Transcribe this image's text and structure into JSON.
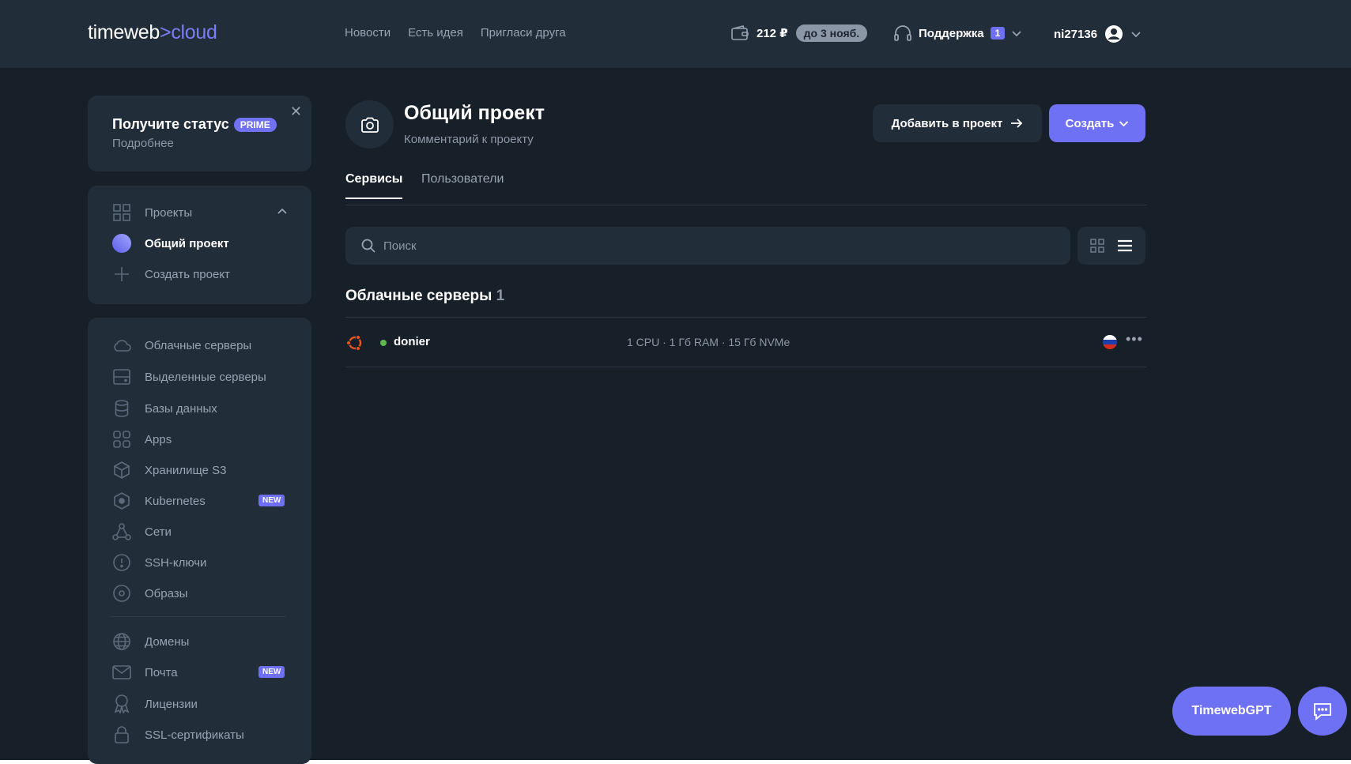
{
  "header": {
    "logo_left": "timeweb",
    "logo_sep": ">",
    "logo_right": "cloud",
    "nav": [
      "Новости",
      "Есть идея",
      "Пригласи друга"
    ],
    "balance": "212 ₽",
    "balance_until": "до 3 нояб.",
    "support_label": "Поддержка",
    "support_count": "1",
    "username": "ni27136"
  },
  "sidebar": {
    "prime_title": "Получите статус",
    "prime_tag": "PRIME",
    "prime_more": "Подробнее",
    "close_glyph": "✕",
    "projects_label": "Проекты",
    "current_project": "Общий проект",
    "create_project": "Создать проект",
    "items": [
      {
        "label": "Облачные серверы",
        "icon": "cloud-icon"
      },
      {
        "label": "Выделенные серверы",
        "icon": "server-icon"
      },
      {
        "label": "Базы данных",
        "icon": "database-icon"
      },
      {
        "label": "Apps",
        "icon": "apps-icon"
      },
      {
        "label": "Хранилище S3",
        "icon": "cube-icon"
      },
      {
        "label": "Kubernetes",
        "icon": "kubernetes-icon",
        "badge": "NEW"
      },
      {
        "label": "Сети",
        "icon": "network-icon"
      },
      {
        "label": "SSH-ключи",
        "icon": "key-icon"
      },
      {
        "label": "Образы",
        "icon": "disc-icon"
      },
      {
        "label": "Домены",
        "icon": "globe-icon"
      },
      {
        "label": "Почта",
        "icon": "mail-icon",
        "badge": "NEW"
      },
      {
        "label": "Лицензии",
        "icon": "license-icon"
      },
      {
        "label": "SSL-сертификаты",
        "icon": "lock-icon"
      }
    ]
  },
  "project": {
    "title": "Общий проект",
    "comment": "Комментарий к проекту",
    "add_button": "Добавить в проект",
    "create_button": "Создать",
    "tabs": [
      "Сервисы",
      "Пользователи"
    ],
    "search_placeholder": "Поиск"
  },
  "section": {
    "title": "Облачные серверы",
    "count": "1"
  },
  "server": {
    "name": "donier",
    "spec": "1 CPU · 1 Гб RAM · 15 Гб NVMe",
    "more": "•••",
    "status_color": "#5cb84f"
  },
  "widgets": {
    "gpt_label": "TimewebGPT"
  },
  "colors": {
    "accent": "#6f71f4",
    "background": "#172029",
    "card": "#222d3a"
  }
}
